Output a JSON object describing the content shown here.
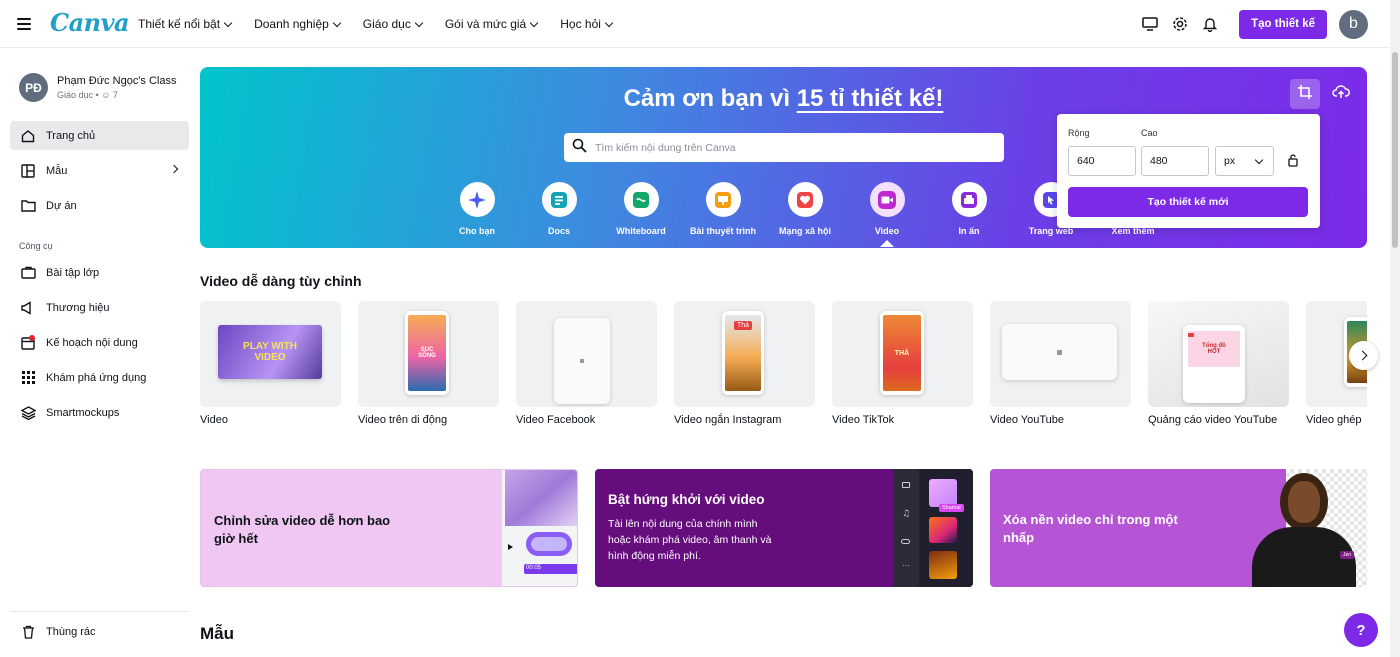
{
  "header": {
    "logo": "Canva",
    "nav": [
      "Thiết kế nổi bật",
      "Doanh nghiệp",
      "Giáo dục",
      "Gói và mức giá",
      "Học hỏi"
    ],
    "create_label": "Tạo thiết kế",
    "avatar_initial": "b",
    "accent": "#7d2ae8"
  },
  "sidebar": {
    "team_initials": "PĐ",
    "team_name": "Phạm Đức Ngọc's Class",
    "team_sub": "Giáo dục •",
    "team_members": "7",
    "items": [
      {
        "label": "Trang chủ",
        "icon": "home-icon"
      },
      {
        "label": "Mẫu",
        "icon": "template-icon"
      },
      {
        "label": "Dự án",
        "icon": "folder-icon"
      }
    ],
    "tools_heading": "Công cụ",
    "tools": [
      {
        "label": "Bài tập lớp",
        "icon": "assignment-icon"
      },
      {
        "label": "Thương hiệu",
        "icon": "brand-icon"
      },
      {
        "label": "Kế hoạch nội dung",
        "icon": "calendar-icon"
      },
      {
        "label": "Khám phá ứng dụng",
        "icon": "apps-icon"
      },
      {
        "label": "Smartmockups",
        "icon": "mockup-icon"
      }
    ],
    "trash": "Thùng rác"
  },
  "hero": {
    "title_prefix": "Cảm ơn bạn vì ",
    "title_highlight": "15 tỉ thiết kế!",
    "search_placeholder": "Tìm kiếm nội dung trên Canva",
    "categories": [
      {
        "label": "Cho bạn",
        "icon": "sparkle-icon",
        "color": "#4a5df5"
      },
      {
        "label": "Docs",
        "icon": "docs-icon",
        "color": "#13a3b5"
      },
      {
        "label": "Whiteboard",
        "icon": "whiteboard-icon",
        "color": "#13a86a"
      },
      {
        "label": "Bài thuyết trình",
        "icon": "presentation-icon",
        "color": "#f59e0b"
      },
      {
        "label": "Mạng xã hội",
        "icon": "heart-icon",
        "color": "#ef4444"
      },
      {
        "label": "Video",
        "icon": "video-icon",
        "color": "#c026d3"
      },
      {
        "label": "In ấn",
        "icon": "print-icon",
        "color": "#8b2ad8"
      },
      {
        "label": "Trang web",
        "icon": "website-icon",
        "color": "#5b46e6"
      },
      {
        "label": "Xem thêm",
        "icon": "more-icon",
        "color": "#6d28d9"
      }
    ],
    "popup": {
      "width_label": "Rộng",
      "height_label": "Cao",
      "width_value": "640",
      "height_value": "480",
      "unit": "px",
      "button": "Tạo thiết kế mới"
    }
  },
  "video_section": {
    "title": "Video dễ dàng tùy chỉnh",
    "cards": [
      {
        "label": "Video",
        "thumb_text": "PLAY WITH VIDEO"
      },
      {
        "label": "Video trên di động",
        "thumb_text": "SUC SỐNG"
      },
      {
        "label": "Video Facebook",
        "thumb_text": ""
      },
      {
        "label": "Video ngắn Instagram",
        "thumb_text": "Thả"
      },
      {
        "label": "Video TikTok",
        "thumb_text": "THẢ"
      },
      {
        "label": "Video YouTube",
        "thumb_text": ""
      },
      {
        "label": "Quảng cáo video YouTube",
        "thumb_text": "Tổng đồ HOT"
      },
      {
        "label": "Video ghép",
        "thumb_text": ""
      }
    ]
  },
  "banners": [
    {
      "title": "Chỉnh sửa video dễ hơn bao giờ hết",
      "body": "",
      "chip": "00:05"
    },
    {
      "title": "Bật hứng khởi với video",
      "body": "Tải lên nội dung của chính mình hoặc khám phá video, âm thanh và hình động miễn phí.",
      "chip": "Shamal"
    },
    {
      "title": "Xóa nền video chỉ trong một nhấp",
      "body": "",
      "chip": "Jen"
    }
  ],
  "templates_section": {
    "title": "Mẫu"
  },
  "help_label": "?"
}
